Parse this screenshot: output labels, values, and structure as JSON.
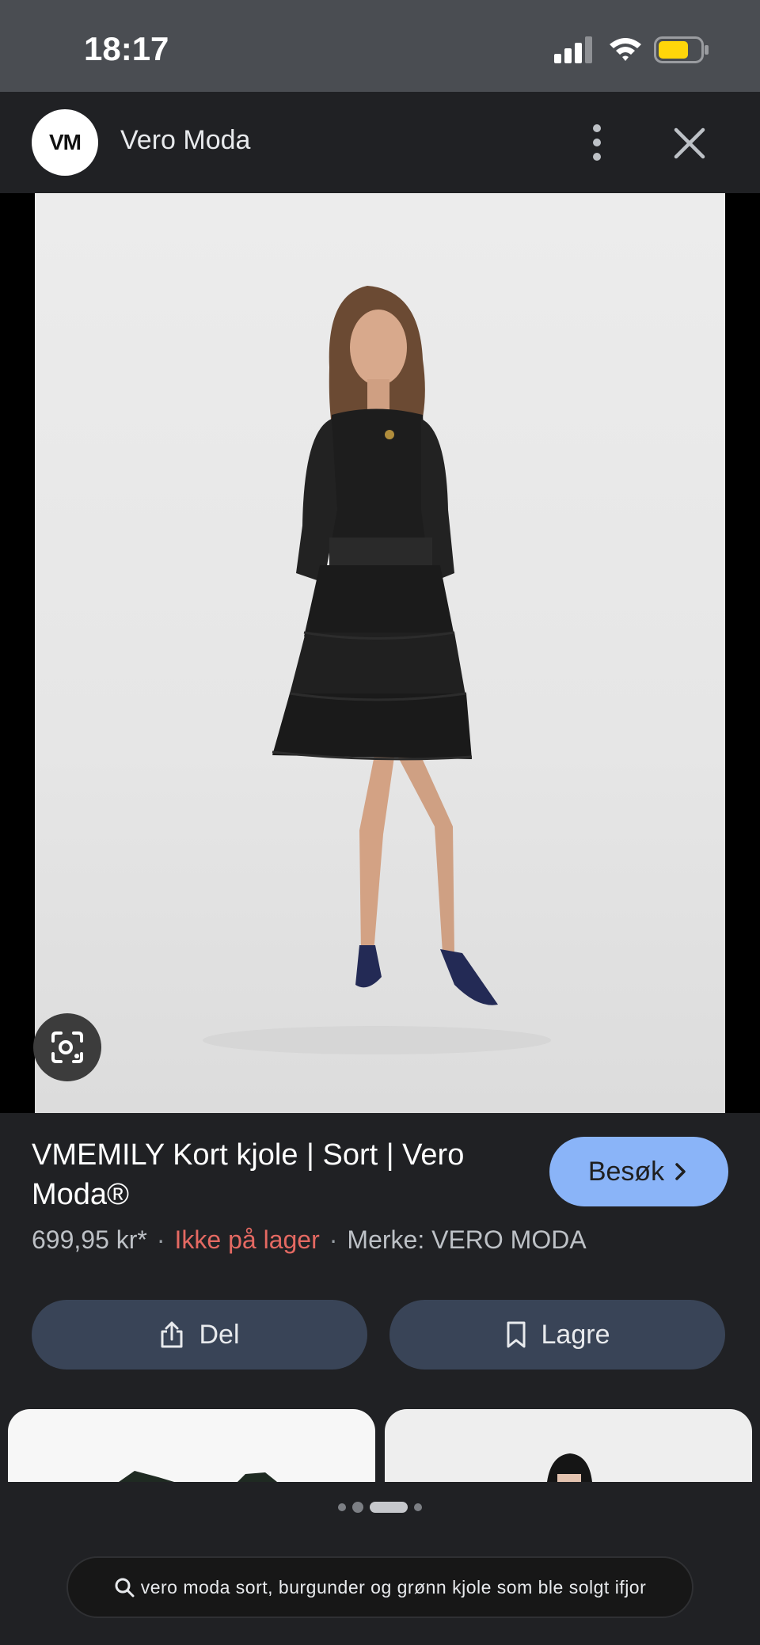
{
  "status_bar": {
    "time": "18:17"
  },
  "source": {
    "logo_text": "VM",
    "name": "Vero Moda"
  },
  "product": {
    "title": "VMEMILY Kort kjole | Sort | Vero Moda®",
    "price": "699,95 kr*",
    "stock_status": "Ikke på lager",
    "brand": "Merke: VERO MODA",
    "separator": "·"
  },
  "actions": {
    "visit_label": "Besøk",
    "share_label": "Del",
    "save_label": "Lagre"
  },
  "pager": {
    "total": 4,
    "active_index": 2
  },
  "search": {
    "query": "vero moda sort, burgunder og grønn kjole som ble solgt ifjor"
  },
  "colors": {
    "accent": "#8ab4f8",
    "stock_red": "#e46962",
    "action_button_bg": "#394457",
    "background": "#202124",
    "battery_fill": "#ffd60a"
  },
  "icons": [
    "signal-icon",
    "wifi-icon",
    "battery-icon",
    "more-vert-icon",
    "close-icon",
    "lens-icon",
    "chevron-right-icon",
    "share-icon",
    "bookmark-icon",
    "search-icon"
  ]
}
